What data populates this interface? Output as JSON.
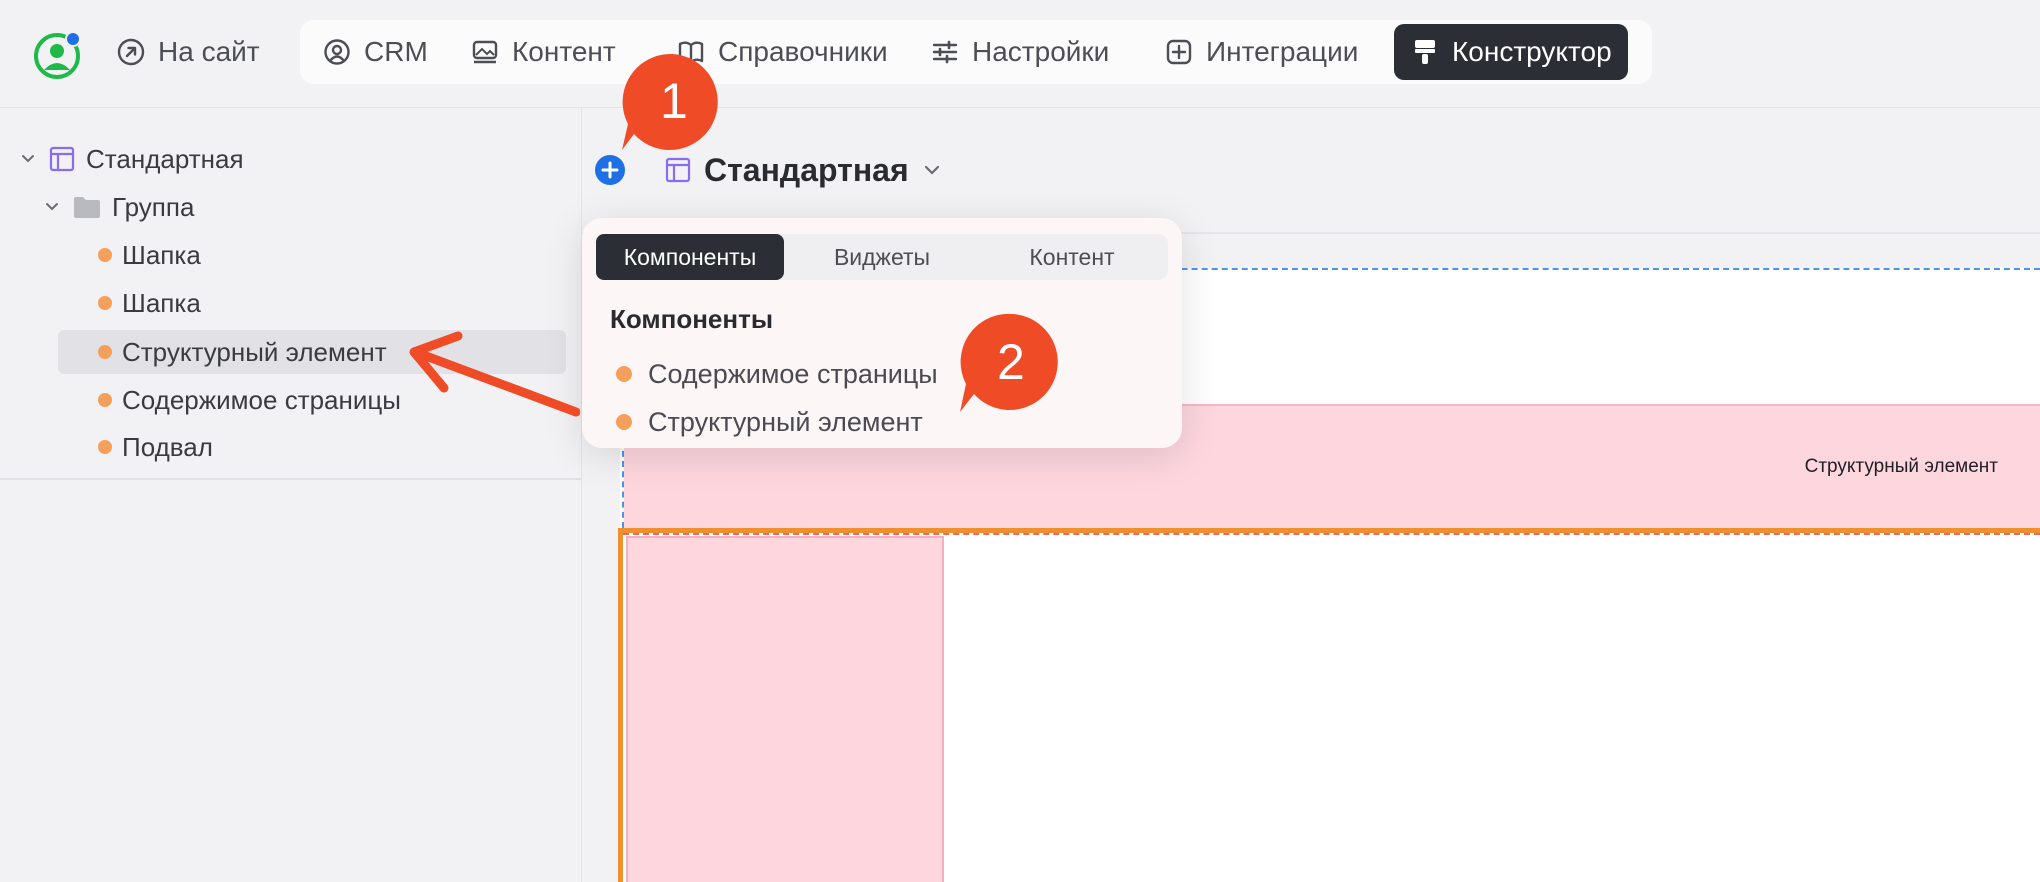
{
  "topbar": {
    "site_link": "На сайт",
    "nav": [
      {
        "label": "CRM",
        "icon": "crm-icon"
      },
      {
        "label": "Контент",
        "icon": "image-icon"
      },
      {
        "label": "Справочники",
        "icon": "book-icon"
      },
      {
        "label": "Настройки",
        "icon": "sliders-icon"
      },
      {
        "label": "Интеграции",
        "icon": "plus-square-icon"
      },
      {
        "label": "Конструктор",
        "icon": "paint-roller-icon",
        "active": true
      }
    ]
  },
  "sidebar": {
    "tree": [
      {
        "label": "Стандартная",
        "type": "layout"
      },
      {
        "label": "Группа",
        "type": "folder"
      },
      {
        "label": "Шапка",
        "type": "component"
      },
      {
        "label": "Шапка",
        "type": "component"
      },
      {
        "label": "Структурный элемент",
        "type": "component",
        "selected": true
      },
      {
        "label": "Содержимое страницы",
        "type": "component"
      },
      {
        "label": "Подвал",
        "type": "component"
      }
    ]
  },
  "canvas": {
    "page_title": "Стандартная",
    "band_label": "Структурный элемент"
  },
  "popover": {
    "tabs": [
      "Компоненты",
      "Виджеты",
      "Контент"
    ],
    "active_tab": "Компоненты",
    "heading": "Компоненты",
    "items": [
      "Содержимое страницы",
      "Структурный элемент"
    ]
  },
  "callouts": [
    "1",
    "2"
  ],
  "colors": {
    "accent_dark": "#2c2e35",
    "component_dot": "#f5a05a",
    "callout": "#ef4b27",
    "add_button": "#1f6fe5",
    "layout_icon": "#8a6cf0",
    "structural_pink": "#fdd6de",
    "selected_frame": "#f0902c"
  }
}
